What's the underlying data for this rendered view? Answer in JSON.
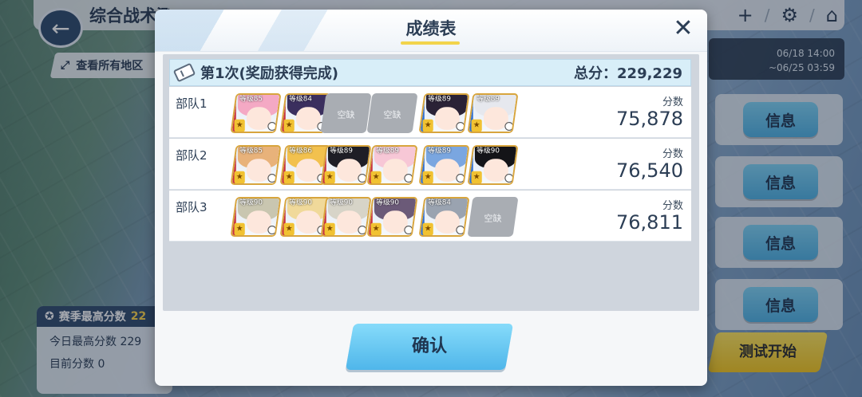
{
  "background": {
    "title": "综合战术测试",
    "region_button": "查看所有地区",
    "date_range_start": "06/18 14:00",
    "date_range_end": "~06/25 03:59",
    "info_buttons": [
      "信息",
      "信息",
      "信息",
      "信息"
    ],
    "test_start": "测试开始",
    "season_high_label": "赛季最高分数",
    "season_high_value": "22",
    "today_high_label": "今日最高分数",
    "today_high_value": "229",
    "current_label": "目前分数",
    "current_value": "0"
  },
  "modal": {
    "title": "成绩表",
    "attempt_label": "第1次(奖励获得完成)",
    "total_label": "总分：",
    "total_value": "229,229",
    "score_label": "分数",
    "empty_label": "空缺",
    "confirm": "确认",
    "teams": [
      {
        "name": "部队1",
        "score": "75,878",
        "slots": [
          {
            "type": "filled",
            "level": "等级85",
            "hair": "#f4a9c4"
          },
          {
            "type": "filled",
            "level": "等级84",
            "hair": "#3b2f5e"
          },
          {
            "type": "empty"
          },
          {
            "type": "empty"
          },
          {
            "type": "filled",
            "level": "等级89",
            "hair": "#2a2236"
          },
          {
            "type": "filled",
            "level": "等级89",
            "hair": "#e6e8ee"
          }
        ]
      },
      {
        "name": "部队2",
        "score": "76,540",
        "slots": [
          {
            "type": "filled",
            "level": "等级85",
            "hair": "#e8b27a"
          },
          {
            "type": "filled",
            "level": "等级86",
            "hair": "#f2c14e"
          },
          {
            "type": "filled",
            "level": "等级89",
            "hair": "#1e1e26"
          },
          {
            "type": "filled",
            "level": "等级89",
            "hair": "#f7c7d6"
          },
          {
            "type": "filled",
            "level": "等级89",
            "hair": "#7aa6e0"
          },
          {
            "type": "filled",
            "level": "等级90",
            "hair": "#141418"
          }
        ]
      },
      {
        "name": "部队3",
        "score": "76,811",
        "slots": [
          {
            "type": "filled",
            "level": "等级90",
            "hair": "#c9c6b0"
          },
          {
            "type": "filled",
            "level": "等级90",
            "hair": "#f0d99a"
          },
          {
            "type": "filled",
            "level": "等级90",
            "hair": "#d7d4c8"
          },
          {
            "type": "filled",
            "level": "等级90",
            "hair": "#6b5a78"
          },
          {
            "type": "filled",
            "level": "等级84",
            "hair": "#9aa3b0"
          },
          {
            "type": "empty"
          }
        ]
      }
    ]
  }
}
